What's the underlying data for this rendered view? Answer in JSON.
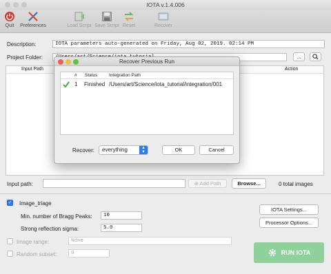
{
  "window": {
    "title": "IOTA v.1.4.006"
  },
  "toolbar": {
    "quit": "Quit",
    "preferences": "Preferences",
    "load_script": "Load Script",
    "save_script": "Save Script",
    "reset": "Reset",
    "recover": "Recover"
  },
  "description": {
    "label": "Description:",
    "value": "IOTA parameters auto-generated on Friday, Aug 02, 2019. 02:14 PM"
  },
  "project_folder": {
    "label": "Project Folder:",
    "value": "/Users/art/Science/iota_tutorial",
    "browse": "...",
    "search_icon": "magnifier-icon"
  },
  "table": {
    "columns": [
      "Input Path",
      "Action"
    ]
  },
  "input_path": {
    "label": "Input path:",
    "value": "",
    "add_button": "Add Path",
    "browse_button": "Browse...",
    "total": "0 total images"
  },
  "image_triage": {
    "label": "Image_triage",
    "checked": true,
    "min_bragg_label": "Min. number of Bragg Peaks:",
    "min_bragg_value": "10",
    "sigma_label": "Strong reflection sigma:",
    "sigma_value": "5.0"
  },
  "image_range": {
    "label": "Image range:",
    "checked": false,
    "value": "None"
  },
  "random_subset": {
    "label": "Random subset:",
    "checked": false,
    "value": "0"
  },
  "buttons": {
    "iota_settings": "IOTA Settings...",
    "processor_options": "Processor Options...",
    "run": "RUN IOTA"
  },
  "dialog": {
    "title": "Recover Previous Run",
    "columns": [
      "#",
      "Status",
      "Integration Path"
    ],
    "rows": [
      {
        "num": "1",
        "status": "Finished",
        "path": "/Users/art/Science/iota_tutorial/integration/001"
      }
    ],
    "recover_label": "Recover:",
    "recover_value": "everything",
    "ok": "OK",
    "cancel": "Cancel"
  },
  "colors": {
    "accent": "#2f7be5",
    "run_button": "#8fd19a",
    "check_mark": "#3fae3f"
  }
}
